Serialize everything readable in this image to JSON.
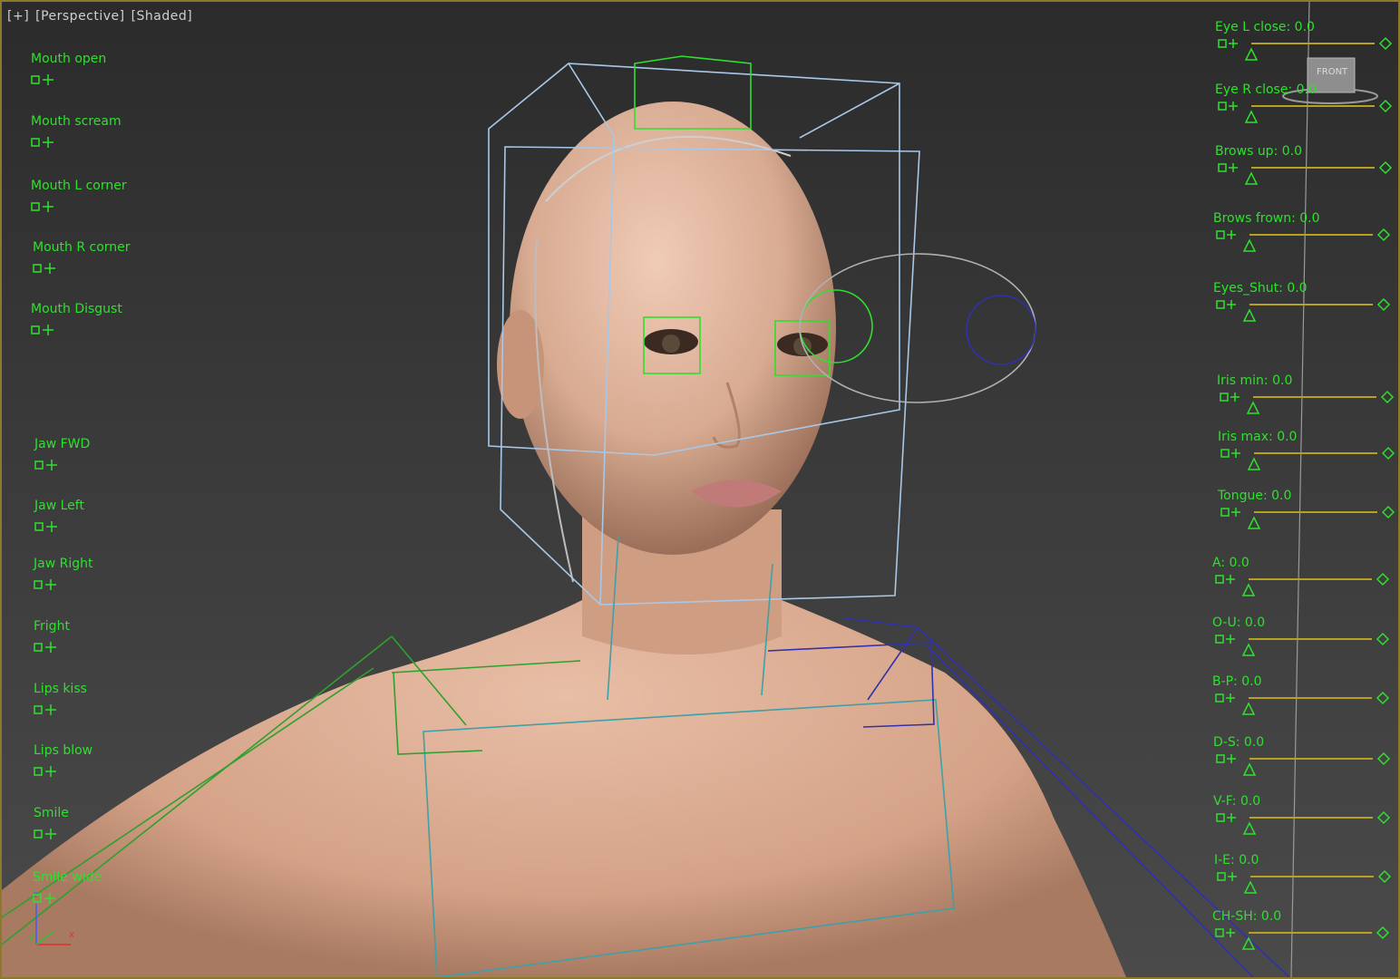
{
  "viewport": {
    "label": [
      "[+]",
      "[Perspective]",
      "[Shaded]"
    ],
    "viewcube_label": "FRONT",
    "axis_labels": [
      "z",
      "y",
      "x"
    ]
  },
  "left_controls": [
    {
      "label": "Mouth open"
    },
    {
      "label": "Mouth scream"
    },
    {
      "label": "Mouth L corner"
    },
    {
      "label": "Mouth R corner"
    },
    {
      "label": "Mouth Disgust"
    },
    {
      "label": "Jaw FWD"
    },
    {
      "label": "Jaw Left"
    },
    {
      "label": "Jaw Right"
    },
    {
      "label": "Fright"
    },
    {
      "label": "Lips kiss"
    },
    {
      "label": "Lips blow"
    },
    {
      "label": "Smile"
    },
    {
      "label": "Smile wide"
    }
  ],
  "right_sliders": [
    {
      "label": "Eye L close: 0.0",
      "value": 0.0
    },
    {
      "label": "Eye R close: 0.0",
      "value": 0.0
    },
    {
      "label": "Brows up: 0.0",
      "value": 0.0
    },
    {
      "label": "Brows frown: 0.0",
      "value": 0.0
    },
    {
      "label": "Eyes_Shut: 0.0",
      "value": 0.0
    },
    {
      "label": "Iris min: 0.0",
      "value": 0.0
    },
    {
      "label": "Iris max: 0.0",
      "value": 0.0
    },
    {
      "label": "Tongue: 0.0",
      "value": 0.0
    },
    {
      "label": "A: 0.0",
      "value": 0.0
    },
    {
      "label": "O-U: 0.0",
      "value": 0.0
    },
    {
      "label": "B-P: 0.0",
      "value": 0.0
    },
    {
      "label": "D-S: 0.0",
      "value": 0.0
    },
    {
      "label": "V-F: 0.0",
      "value": 0.0
    },
    {
      "label": "I-E: 0.0",
      "value": 0.0
    },
    {
      "label": "CH-SH: 0.0",
      "value": 0.0
    }
  ],
  "colors": {
    "control_green": "#2ee02e",
    "slider_track": "#b8a020",
    "rig_blue": "#a8c8e8",
    "rig_navy": "#3030b0",
    "skin": "#d9a98e"
  }
}
